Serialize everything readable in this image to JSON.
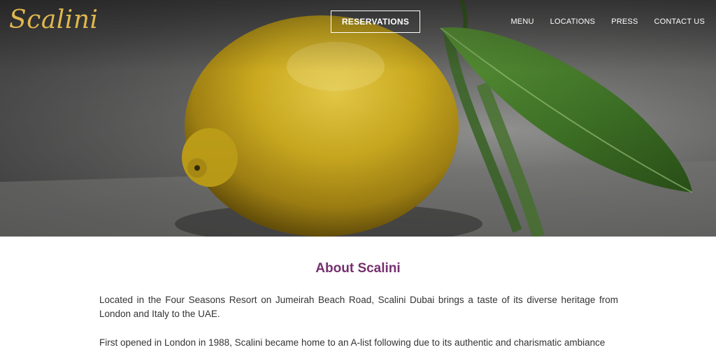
{
  "header": {
    "logo_text": "Scalini",
    "reservations_label": "RESERVATIONS",
    "nav": [
      {
        "label": "MENU"
      },
      {
        "label": "LOCATIONS"
      },
      {
        "label": "PRESS"
      },
      {
        "label": "CONTACT US"
      }
    ]
  },
  "hero": {
    "image_subject": "lemon-with-leaves"
  },
  "about": {
    "title": "About Scalini",
    "paragraphs": [
      "Located in the Four Seasons Resort on Jumeirah Beach Road, Scalini Dubai brings a taste of its diverse heritage from London and Italy to the UAE.",
      "First opened in London in 1988, Scalini became home to an A-list following due to its authentic and charismatic ambiance"
    ]
  },
  "colors": {
    "logo": "#e0b74f",
    "title": "#76306f",
    "body_text": "#333333"
  }
}
